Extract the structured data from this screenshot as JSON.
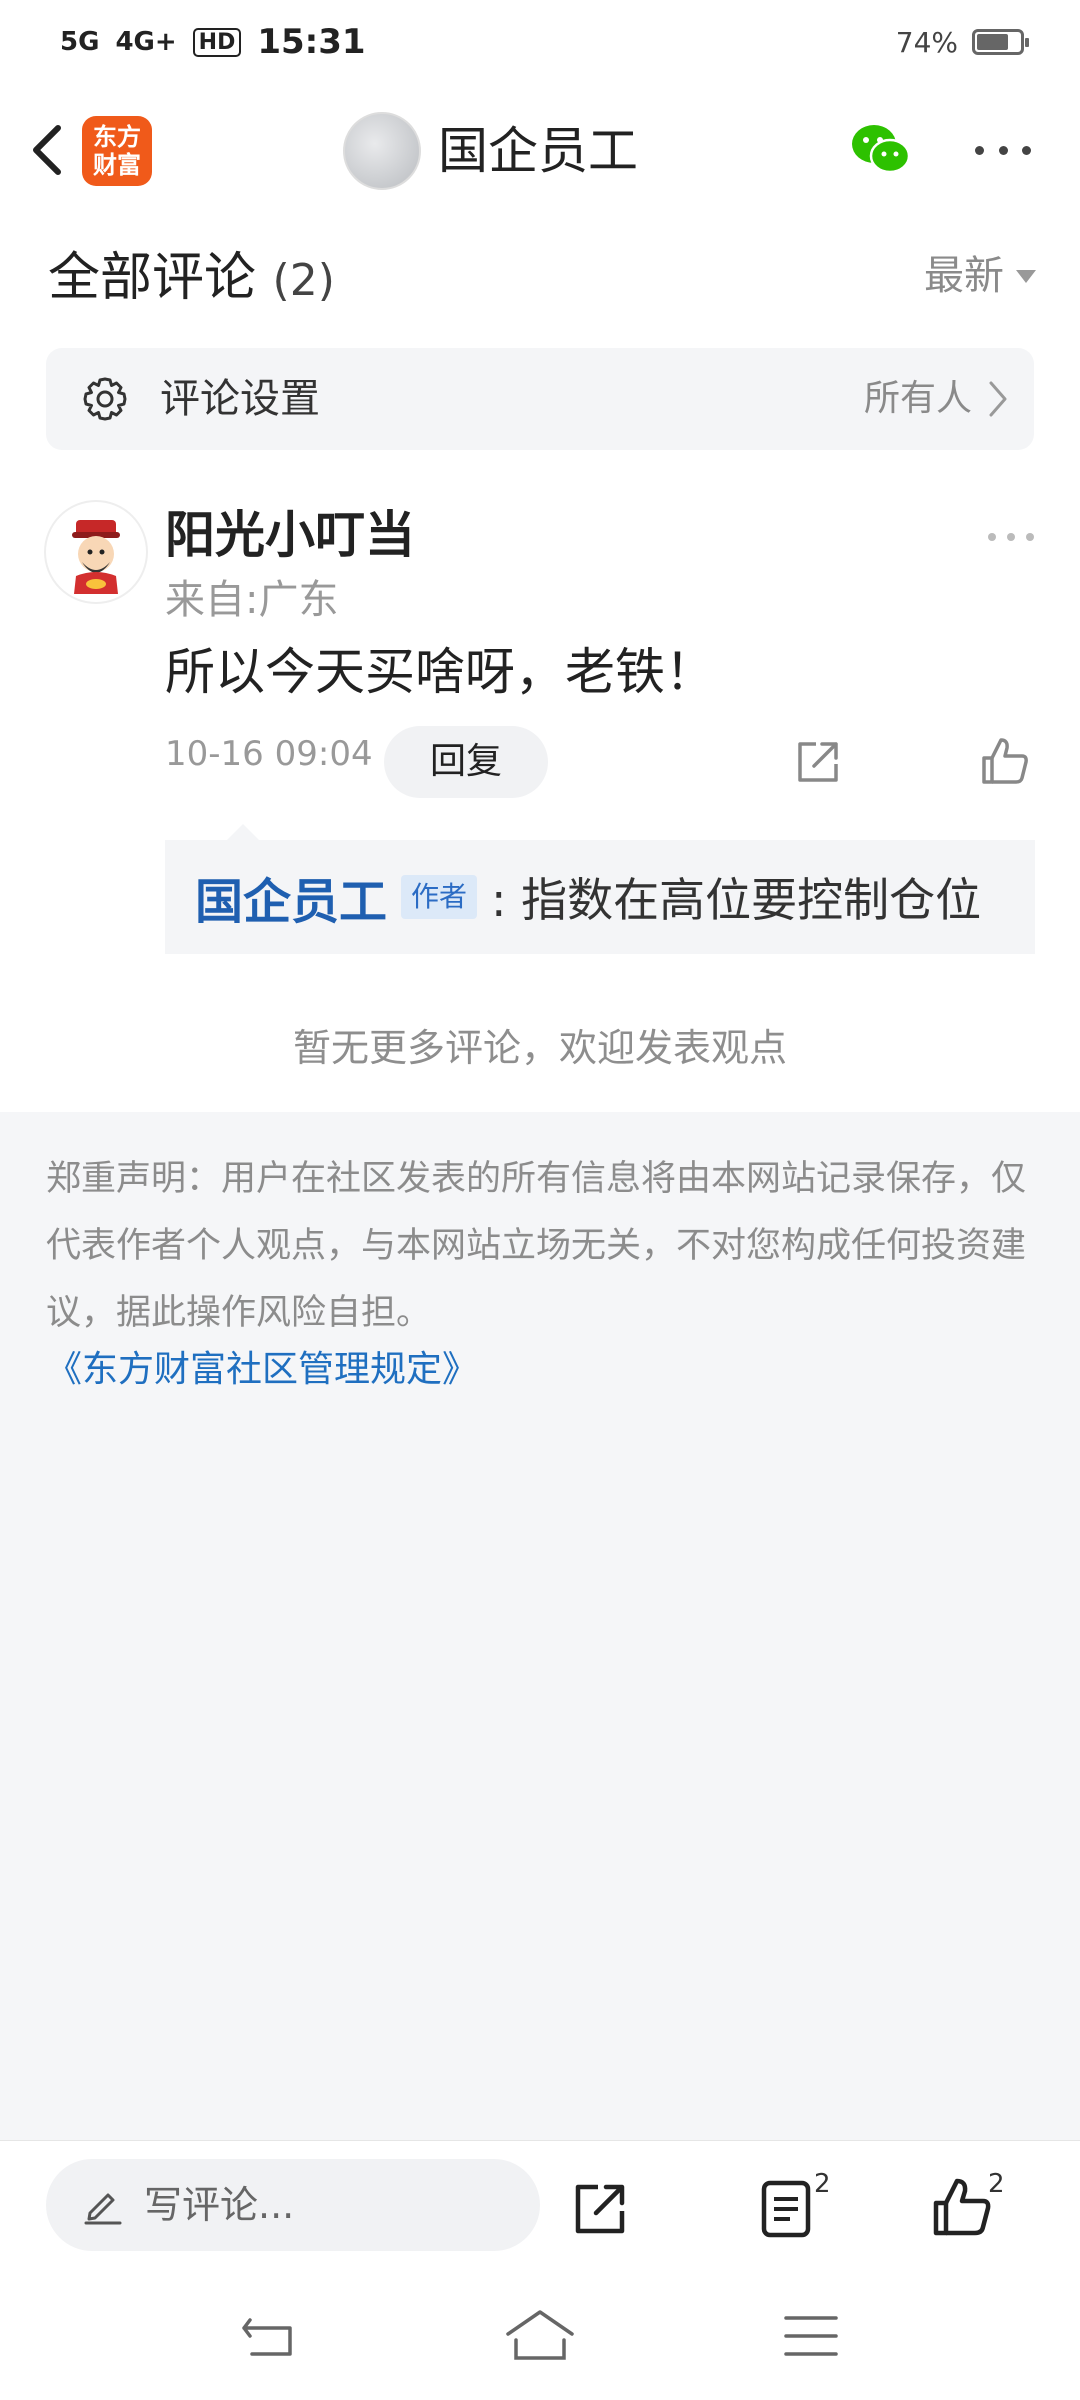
{
  "status_bar": {
    "network_1": "5G",
    "network_2": "4G+",
    "hd_label": "HD",
    "time": "15:31",
    "battery_text": "74%",
    "battery_level": 0.74
  },
  "header": {
    "logo_line1": "东方",
    "logo_line2": "财富",
    "title": "国企员工",
    "icons": [
      "back-icon",
      "wechat-icon",
      "more-icon"
    ]
  },
  "comments": {
    "title": "全部评论",
    "count": "(2)",
    "sort_label": "最新",
    "settings_label": "评论设置",
    "settings_value": "所有人",
    "items": [
      {
        "name": "阳光小叮当",
        "location": "来自:广东",
        "text": "所以今天买啥呀，老铁！",
        "time": "10-16 09:04",
        "reply_label": "回复",
        "replies": [
          {
            "author": "国企员工",
            "tag": "作者",
            "text": ": 指数在高位要控制仓位"
          }
        ]
      }
    ],
    "no_more": "暂无更多评论，欢迎发表观点"
  },
  "disclaimer": {
    "text": "郑重声明：用户在社区发表的所有信息将由本网站记录保存，仅代表作者个人观点，与本网站立场无关，不对您构成任何投资建议，据此操作风险自担。",
    "rules_link": "《东方财富社区管理规定》"
  },
  "bottom_bar": {
    "write_placeholder": "写评论...",
    "comment_count": "2",
    "like_count": "2"
  },
  "colors": {
    "brand": "#f05a1a",
    "link": "#1f6fc0",
    "author_name": "#1f5fb0",
    "wechat": "#2dc100"
  }
}
